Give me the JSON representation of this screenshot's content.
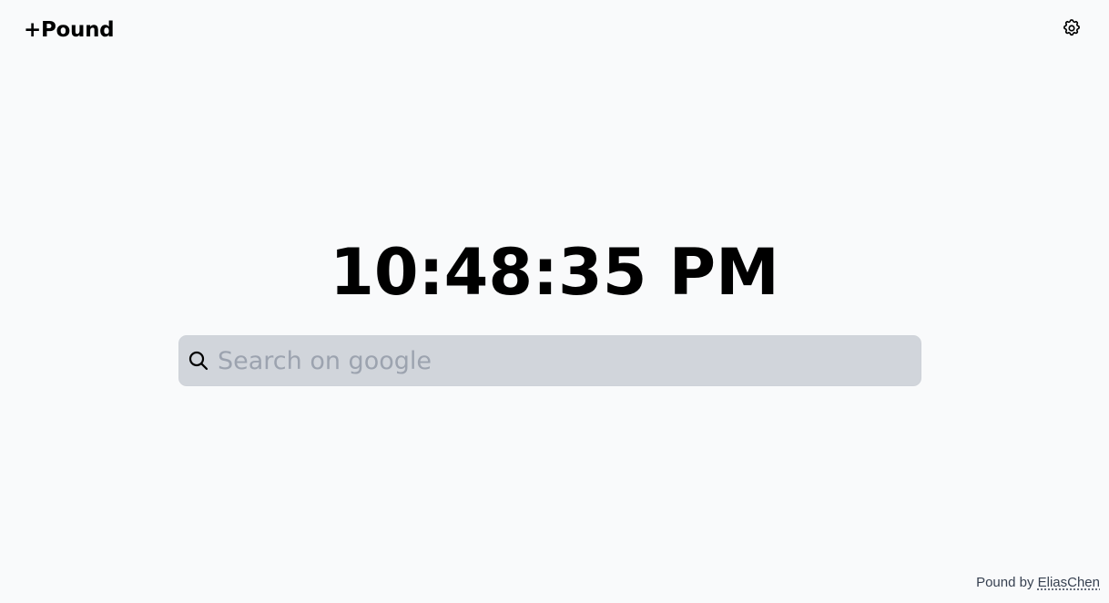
{
  "header": {
    "logo_text": "+Pound",
    "settings_icon": "gear-icon"
  },
  "clock": {
    "time": "10:48:35 PM"
  },
  "search": {
    "icon": "search-icon",
    "placeholder": "Search on google",
    "value": ""
  },
  "footer": {
    "prefix": "Pound by ",
    "author_link": "EliasChen"
  },
  "colors": {
    "background": "#f9fafb",
    "search_background": "#d1d5db",
    "placeholder": "#9ca3af",
    "text": "#000000",
    "footer_text": "#374151"
  }
}
